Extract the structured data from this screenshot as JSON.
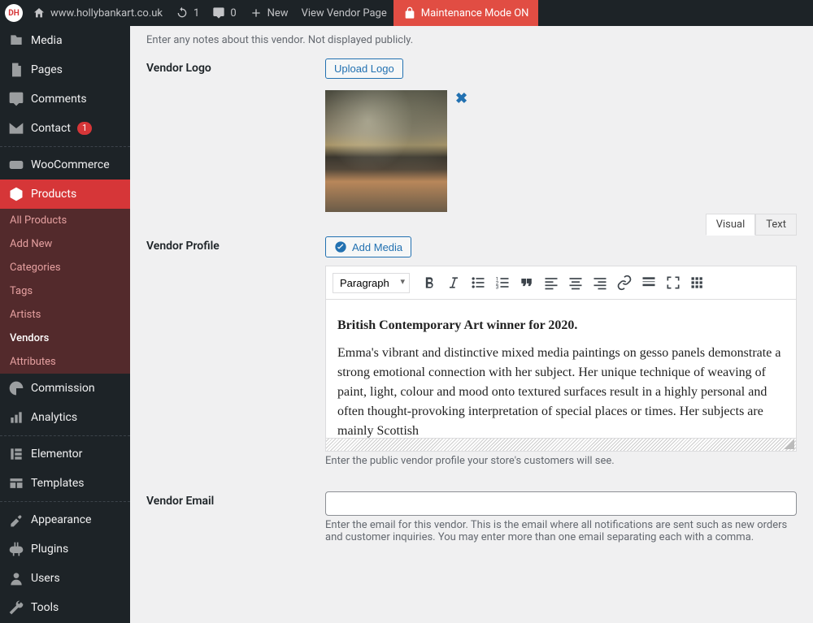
{
  "adminbar": {
    "site_name": "www.hollybankart.co.uk",
    "updates_count": "1",
    "comments_count": "0",
    "new_label": "New",
    "view_vendor_label": "View Vendor Page",
    "maintenance_label": "Maintenance Mode ON"
  },
  "sidebar": {
    "items": [
      {
        "label": "Media"
      },
      {
        "label": "Pages"
      },
      {
        "label": "Comments"
      },
      {
        "label": "Contact",
        "badge": "1"
      },
      {
        "label": "WooCommerce"
      },
      {
        "label": "Products"
      },
      {
        "label": "Commission"
      },
      {
        "label": "Analytics"
      },
      {
        "label": "Elementor"
      },
      {
        "label": "Templates"
      },
      {
        "label": "Appearance"
      },
      {
        "label": "Plugins"
      },
      {
        "label": "Users"
      },
      {
        "label": "Tools"
      }
    ],
    "submenu": {
      "items": [
        {
          "label": "All Products"
        },
        {
          "label": "Add New"
        },
        {
          "label": "Categories"
        },
        {
          "label": "Tags"
        },
        {
          "label": "Artists"
        },
        {
          "label": "Vendors"
        },
        {
          "label": "Attributes"
        }
      ]
    }
  },
  "form": {
    "notes_desc": "Enter any notes about this vendor. Not displayed publicly.",
    "logo_label": "Vendor Logo",
    "upload_logo_btn": "Upload Logo",
    "profile_label": "Vendor Profile",
    "add_media_btn": "Add Media",
    "tabs": {
      "visual": "Visual",
      "text": "Text"
    },
    "format_select": "Paragraph",
    "profile_heading": "British Contemporary Art winner for 2020.",
    "profile_body": "Emma's vibrant and distinctive mixed media paintings on gesso panels demonstrate a strong emotional connection with her subject. Her unique technique of weaving of paint, light, colour and mood onto textured surfaces result in a highly personal and often thought-provoking interpretation of special places or times. Her subjects are mainly Scottish",
    "profile_desc": "Enter the public vendor profile your store's customers will see.",
    "email_label": "Vendor Email",
    "email_value": "",
    "email_desc": "Enter the email for this vendor. This is the email where all notifications are sent such as new orders and customer inquiries. You may enter more than one email separating each with a comma."
  }
}
